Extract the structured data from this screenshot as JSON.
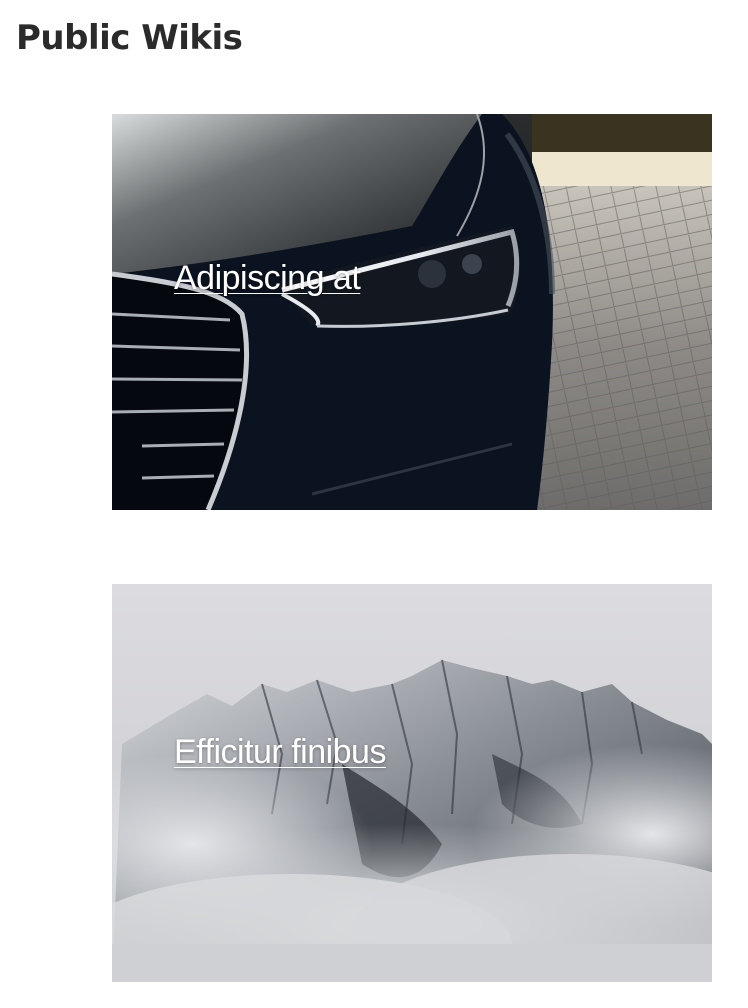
{
  "header": {
    "title": "Public Wikis"
  },
  "wikis": [
    {
      "title": "Adipiscing at",
      "image": "car-headlight-image"
    },
    {
      "title": "Efficitur finibus",
      "image": "misty-mountain-image"
    }
  ],
  "colors": {
    "title_text": "#2b2b2b",
    "card_text": "#ffffff",
    "background": "#ffffff"
  }
}
